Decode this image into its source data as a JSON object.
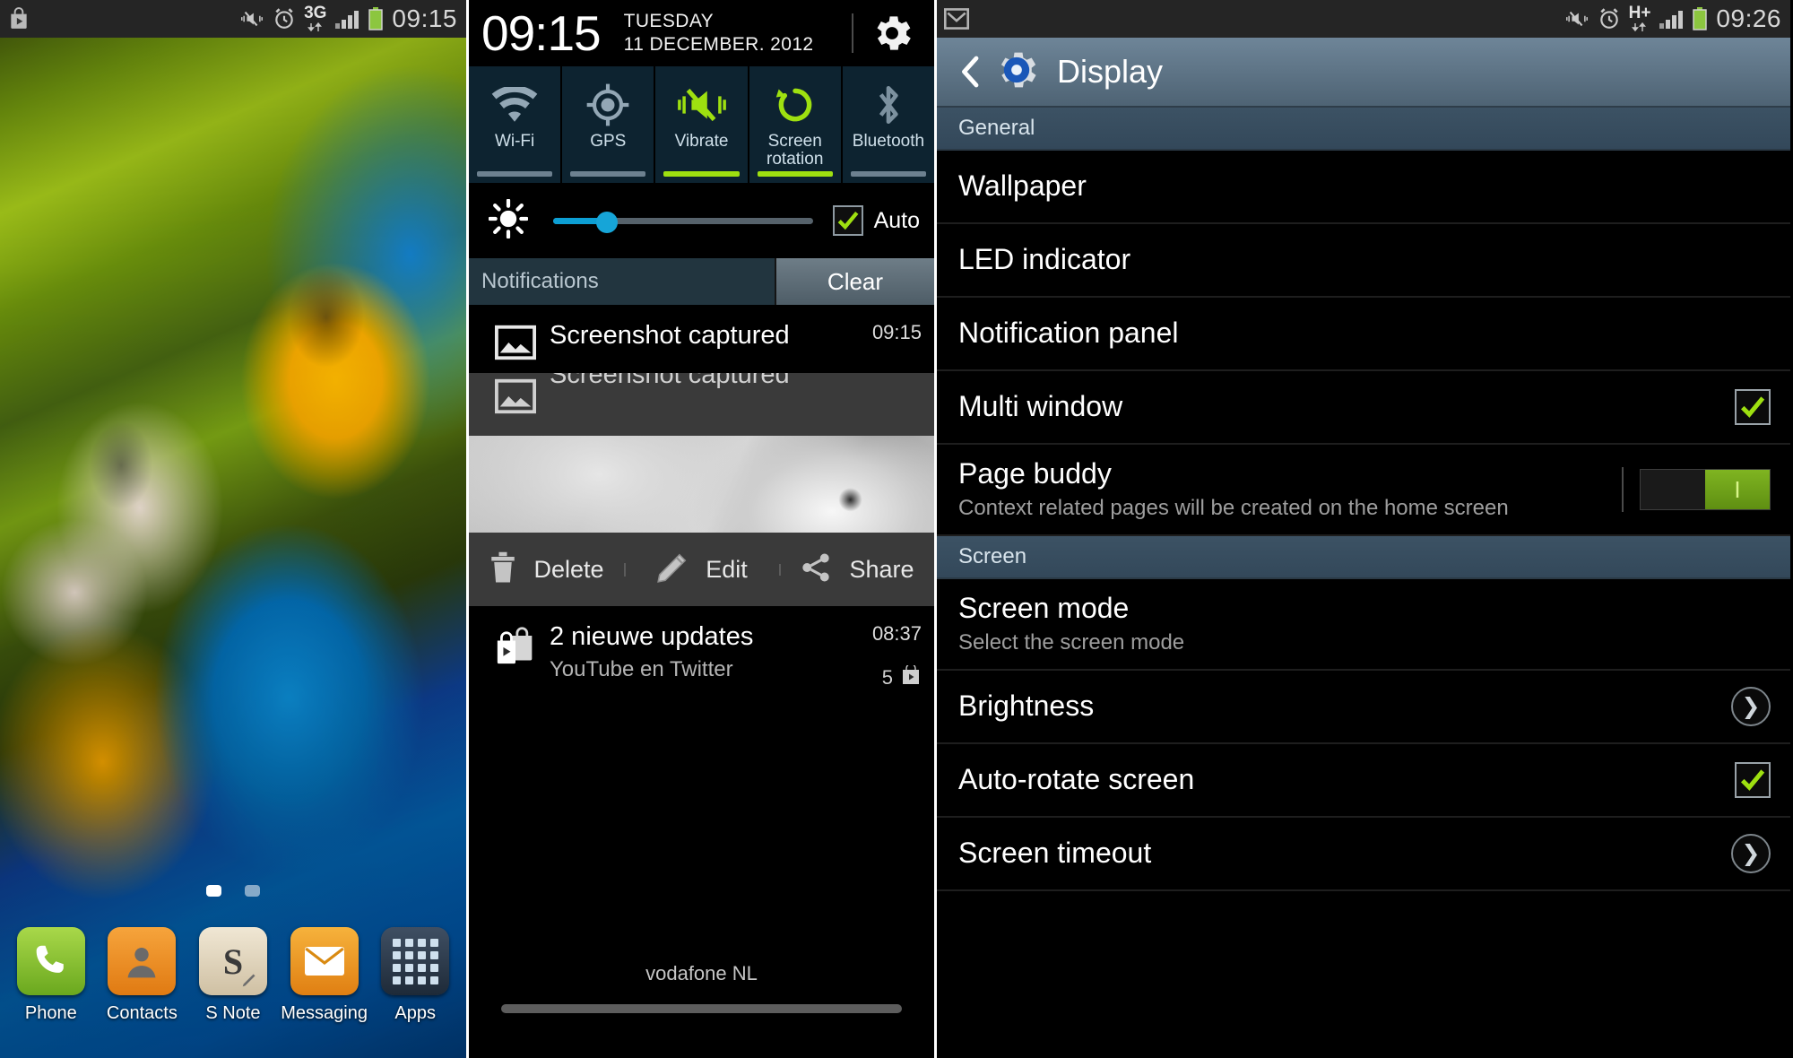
{
  "home": {
    "statusbar": {
      "left_icons": [
        "play-store-icon"
      ],
      "right_icons": [
        "vibrate-mute-icon",
        "alarm-icon",
        "3g-data-icon",
        "signal-bars-icon",
        "battery-icon"
      ],
      "network_label": "3G",
      "clock": "09:15"
    },
    "page_indicator": {
      "total": 2,
      "active": 0
    },
    "dock": [
      {
        "label": "Phone",
        "icon": "phone-icon"
      },
      {
        "label": "Contacts",
        "icon": "contacts-icon"
      },
      {
        "label": "S Note",
        "icon": "s-note-icon"
      },
      {
        "label": "Messaging",
        "icon": "messaging-icon"
      },
      {
        "label": "Apps",
        "icon": "apps-grid-icon"
      }
    ]
  },
  "notification_panel": {
    "time": "09:15",
    "day_of_week": "TUESDAY",
    "date": "11 DECEMBER. 2012",
    "settings_icon": "gear-icon",
    "toggles": [
      {
        "label": "Wi-Fi",
        "icon": "wifi-icon",
        "state": "off"
      },
      {
        "label": "GPS",
        "icon": "gps-icon",
        "state": "off"
      },
      {
        "label": "Vibrate",
        "icon": "vibrate-icon",
        "state": "on"
      },
      {
        "label": "Screen rotation",
        "icon": "screen-rotation-icon",
        "state": "on"
      },
      {
        "label": "Bluetooth",
        "icon": "bluetooth-icon",
        "state": "off"
      }
    ],
    "brightness": {
      "icon": "brightness-icon",
      "value_percent": 18,
      "auto_label": "Auto",
      "auto_checked": true
    },
    "notifications_header": "Notifications",
    "clear_label": "Clear",
    "items": [
      {
        "icon": "image-icon",
        "title": "Screenshot captured",
        "time": "09:15"
      },
      {
        "icon": "image-icon",
        "title": "Screenshot captured",
        "time": ""
      }
    ],
    "screenshot_actions": [
      {
        "label": "Delete",
        "icon": "trash-icon"
      },
      {
        "label": "Edit",
        "icon": "pencil-icon"
      },
      {
        "label": "Share",
        "icon": "share-icon"
      }
    ],
    "update_notification": {
      "icon": "play-store-icon",
      "title": "2 nieuwe updates",
      "subtitle": "YouTube en Twitter",
      "time": "08:37",
      "count": "5",
      "count_icon": "play-store-icon"
    },
    "carrier": "vodafone NL"
  },
  "settings": {
    "statusbar": {
      "left_icons": [
        "gmail-icon"
      ],
      "right_icons": [
        "vibrate-mute-icon",
        "alarm-icon",
        "hplus-data-icon",
        "signal-bars-icon",
        "battery-icon"
      ],
      "network_label": "H+",
      "clock": "09:26"
    },
    "actionbar": {
      "back_icon": "back-chevron-icon",
      "app_icon": "settings-gear-icon",
      "title": "Display"
    },
    "sections": [
      {
        "label": "General",
        "rows": [
          {
            "title": "Wallpaper",
            "sub": "",
            "control": "none"
          },
          {
            "title": "LED indicator",
            "sub": "",
            "control": "none"
          },
          {
            "title": "Notification panel",
            "sub": "",
            "control": "none"
          },
          {
            "title": "Multi window",
            "sub": "",
            "control": "checkbox",
            "checked": true
          },
          {
            "title": "Page buddy",
            "sub": "Context related pages will be created on the home screen",
            "control": "switch",
            "switch_on": true,
            "switch_label": "I"
          }
        ]
      },
      {
        "label": "Screen",
        "rows": [
          {
            "title": "Screen mode",
            "sub": "Select the screen mode",
            "control": "none"
          },
          {
            "title": "Brightness",
            "sub": "",
            "control": "arrow"
          },
          {
            "title": "Auto-rotate screen",
            "sub": "",
            "control": "checkbox",
            "checked": true
          },
          {
            "title": "Screen timeout",
            "sub": "",
            "control": "arrow"
          }
        ]
      }
    ]
  },
  "colors": {
    "accent_green": "#9ee010",
    "accent_blue": "#16a5d8",
    "actionbar": "#5e7486",
    "section_header": "#384d5f",
    "toggle_bg": "#0d2330"
  }
}
